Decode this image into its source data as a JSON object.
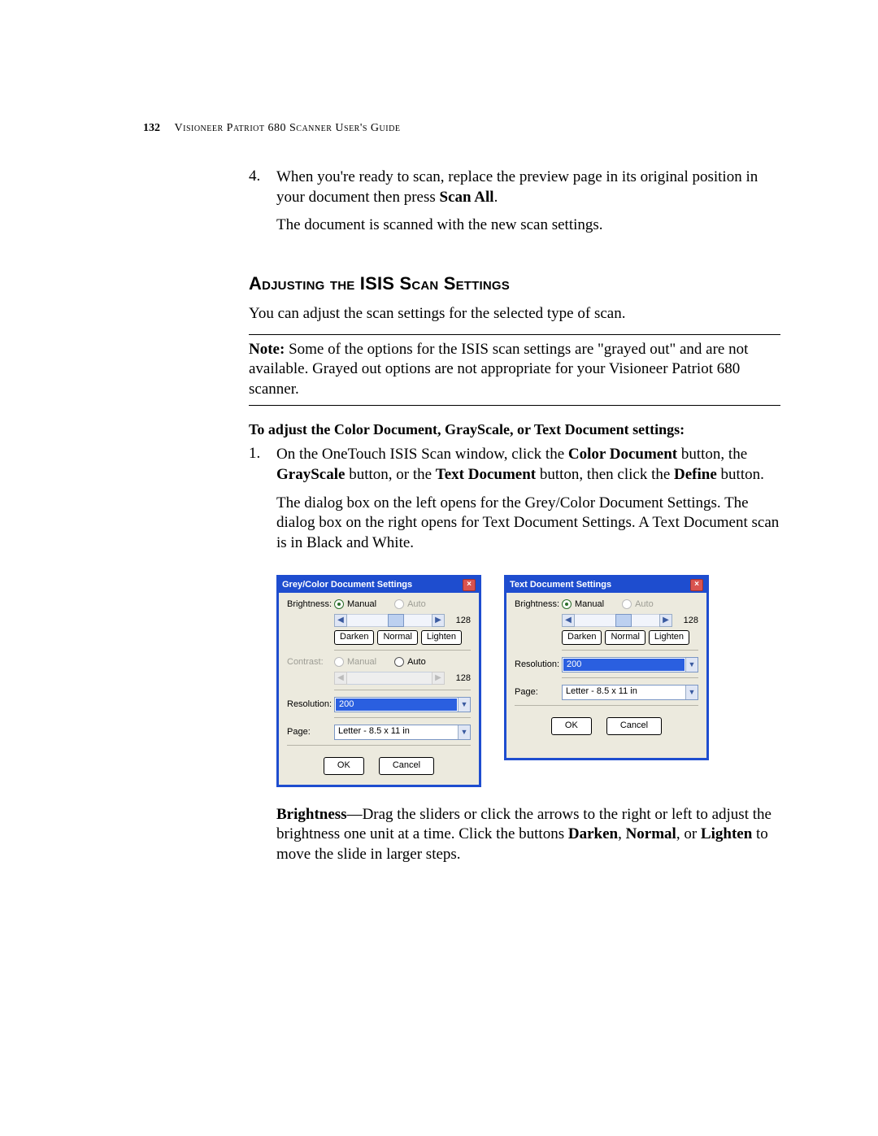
{
  "header": {
    "page_number": "132",
    "guide_title": "Visioneer Patriot 680 Scanner User's Guide"
  },
  "step4": {
    "num": "4.",
    "line1_a": "When you're ready to scan, replace the preview page in its original position in your document then press ",
    "line1_b": "Scan All",
    "line1_c": ".",
    "line2": "The document is scanned with the new scan settings."
  },
  "section_heading": "Adjusting the ISIS Scan Settings",
  "intro_para": "You can adjust the scan settings for the selected type of scan.",
  "note": {
    "label": "Note:",
    "body": " Some of the options for the ISIS scan settings are \"grayed out\" and are not available. Grayed out options are not appropriate for your Visioneer Patriot 680 scanner."
  },
  "subhead": "To adjust the Color Document, GrayScale, or Text Document settings:",
  "step1": {
    "num": "1.",
    "p1_a": "On the OneTouch ISIS Scan window, click the ",
    "p1_b": "Color Document",
    "p1_c": " button, the ",
    "p1_d": "GrayScale",
    "p1_e": " button, or the ",
    "p1_f": "Text Document",
    "p1_g": " button, then click the ",
    "p1_h": "Define",
    "p1_i": " button.",
    "p2": "The dialog box on the left opens for the Grey/Color Document Settings. The dialog box on the right opens for Text Document Settings. A Text Document scan is in Black and White."
  },
  "dlg_left": {
    "title": "Grey/Color Document Settings",
    "brightness_label": "Brightness:",
    "manual": "Manual",
    "auto": "Auto",
    "val128": "128",
    "darken": "Darken",
    "normal": "Normal",
    "lighten": "Lighten",
    "contrast_label": "Contrast:",
    "resolution_label": "Resolution:",
    "resolution_value": "200",
    "page_label": "Page:",
    "page_value": "Letter - 8.5 x 11 in",
    "ok": "OK",
    "cancel": "Cancel"
  },
  "dlg_right": {
    "title": "Text Document Settings",
    "brightness_label": "Brightness:",
    "manual": "Manual",
    "auto": "Auto",
    "val128": "128",
    "darken": "Darken",
    "normal": "Normal",
    "lighten": "Lighten",
    "resolution_label": "Resolution:",
    "resolution_value": "200",
    "page_label": "Page:",
    "page_value": "Letter - 8.5 x 11 in",
    "ok": "OK",
    "cancel": "Cancel"
  },
  "brightness_para": {
    "b1": "Brightness",
    "t1": "—Drag the sliders or click the arrows to the right or left to adjust the brightness one unit at a time. Click the buttons ",
    "b2": "Darken",
    "t2": ", ",
    "b3": "Normal",
    "t3": ", or ",
    "b4": "Lighten",
    "t4": " to move the slide in larger steps."
  }
}
